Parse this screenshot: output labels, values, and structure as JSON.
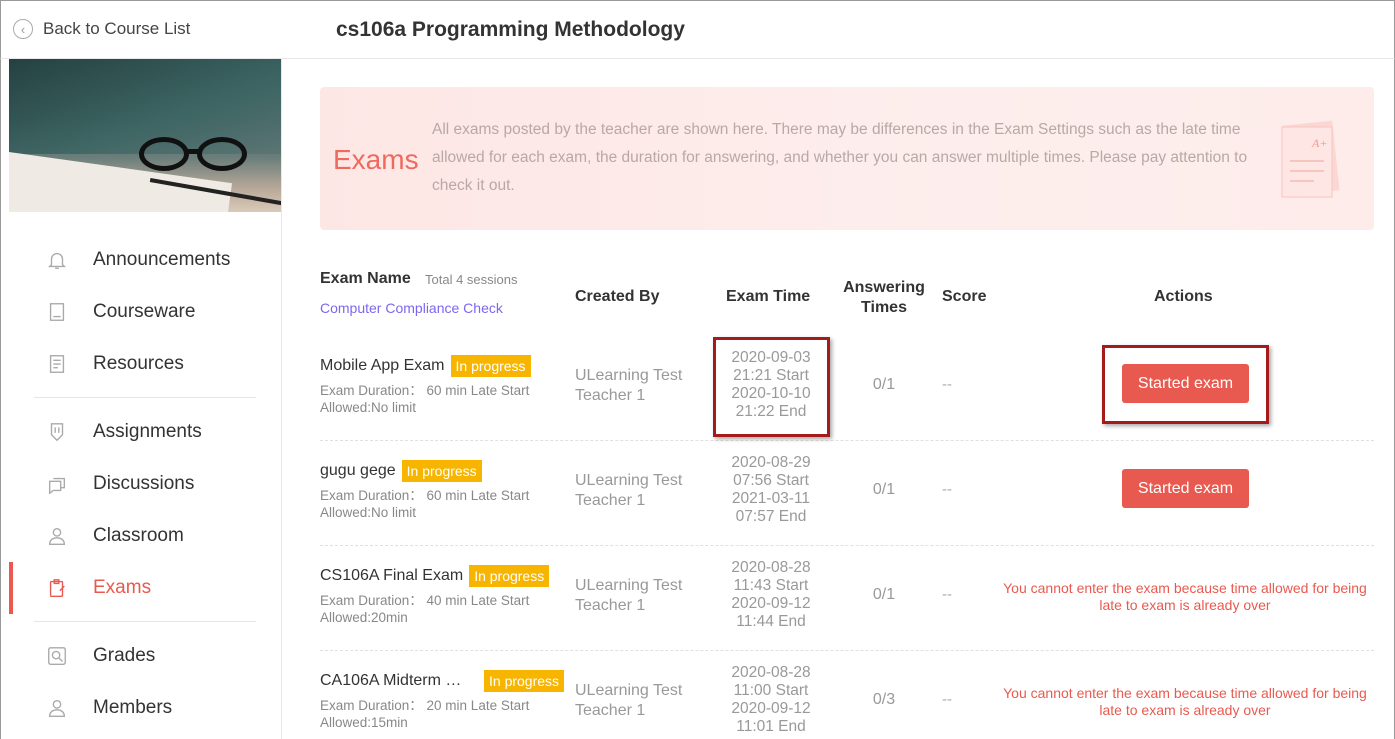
{
  "header": {
    "back_label": "Back to Course List",
    "course_title": "cs106a Programming Methodology"
  },
  "sidebar": {
    "items": [
      {
        "label": "Announcements",
        "icon": "bell-icon"
      },
      {
        "label": "Courseware",
        "icon": "book-icon"
      },
      {
        "label": "Resources",
        "icon": "folder-icon"
      },
      {
        "label": "Assignments",
        "icon": "shield-icon"
      },
      {
        "label": "Discussions",
        "icon": "chat-icon"
      },
      {
        "label": "Classroom",
        "icon": "person-icon"
      },
      {
        "label": "Exams",
        "icon": "clipboard-icon",
        "active": true
      },
      {
        "label": "Grades",
        "icon": "magnifier-icon"
      },
      {
        "label": "Members",
        "icon": "user-icon"
      }
    ]
  },
  "hero": {
    "title": "Exams",
    "description": "All exams posted by the teacher are shown here. There may be differences in the Exam Settings such as the late time allowed for each exam, the duration for answering, and whether you can answer multiple times. Please pay attention to check it out."
  },
  "table": {
    "headers": {
      "exam_name": "Exam Name",
      "total": "Total 4 sessions",
      "compliance_link": "Computer Compliance Check",
      "created_by": "Created By",
      "exam_time": "Exam Time",
      "answering_times_1": "Answering",
      "answering_times_2": "Times",
      "score": "Score",
      "actions": "Actions"
    },
    "rows": [
      {
        "name": "Mobile App Exam",
        "status": "In progress",
        "duration": "Exam Duration： 60 min Late Start",
        "allowed": "Allowed:No limit",
        "creator_1": "ULearning Test",
        "creator_2": "Teacher 1",
        "start_date": "2020-09-03",
        "start_time": "21:21 Start",
        "end_date": "2020-10-10",
        "end_time": "21:22 End",
        "answering": "0/1",
        "score": "--",
        "action": "Started exam"
      },
      {
        "name": "gugu gege",
        "status": "In progress",
        "duration": "Exam Duration： 60 min Late Start",
        "allowed": "Allowed:No limit",
        "creator_1": "ULearning Test",
        "creator_2": "Teacher 1",
        "start_date": "2020-08-29",
        "start_time": "07:56 Start",
        "end_date": "2021-03-11",
        "end_time": "07:57 End",
        "answering": "0/1",
        "score": "--",
        "action": "Started exam"
      },
      {
        "name": "CS106A Final Exam",
        "status": "In progress",
        "duration": "Exam Duration： 40 min Late Start",
        "allowed": "Allowed:20min",
        "creator_1": "ULearning Test",
        "creator_2": "Teacher 1",
        "start_date": "2020-08-28",
        "start_time": "11:43 Start",
        "end_date": "2020-09-12",
        "end_time": "11:44 End",
        "answering": "0/1",
        "score": "--",
        "action_warning_1": "You cannot enter the exam because time allowed for being",
        "action_warning_2": "late to exam is already over"
      },
      {
        "name": "CA106A Midterm …",
        "status": "In progress",
        "duration": "Exam Duration： 20 min Late Start",
        "allowed": "Allowed:15min",
        "creator_1": "ULearning Test",
        "creator_2": "Teacher 1",
        "start_date": "2020-08-28",
        "start_time": "11:00 Start",
        "end_date": "2020-09-12",
        "end_time": "11:01 End",
        "answering": "0/3",
        "score": "--",
        "action_warning_1": "You cannot enter the exam because time allowed for being",
        "action_warning_2": "late to exam is already over"
      }
    ]
  },
  "colors": {
    "accent": "#e85a4f",
    "badge": "#f7b500",
    "highlight_box": "#a31b1b",
    "link": "#7b68ee"
  }
}
